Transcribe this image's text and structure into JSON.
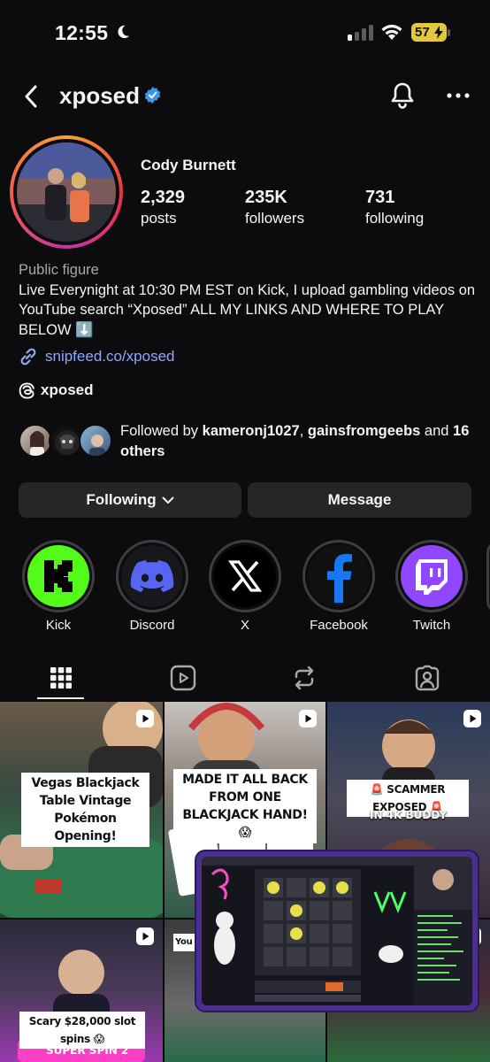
{
  "status_bar": {
    "time": "12:55",
    "battery": "57"
  },
  "header": {
    "username": "xposed"
  },
  "profile": {
    "display_name": "Cody Burnett",
    "stats": [
      {
        "value": "2,329",
        "label": "posts"
      },
      {
        "value": "235K",
        "label": "followers"
      },
      {
        "value": "731",
        "label": "following"
      }
    ],
    "category": "Public figure",
    "bio": "Live Everynight at 10:30 PM EST on Kick, I upload gambling videos on YouTube search “Xposed” ALL MY LINKS AND WHERE TO PLAY BELOW ⬇️",
    "link": "snipfeed.co/xposed",
    "threads": "xposed",
    "followed_by": {
      "prefix": "Followed by ",
      "user1": "kameronj1027",
      "separator": ", ",
      "user2": "gainsfromgeebs",
      "and_text": " and ",
      "others": "16 others"
    }
  },
  "actions": {
    "following_label": "Following",
    "message_label": "Message"
  },
  "highlights": [
    {
      "label": "Kick",
      "icon": "kick-icon",
      "color": "#53fc18"
    },
    {
      "label": "Discord",
      "icon": "discord-icon",
      "color": "#5865f2"
    },
    {
      "label": "X",
      "icon": "x-icon",
      "color": "#ffffff"
    },
    {
      "label": "Facebook",
      "icon": "facebook-icon",
      "color": "#1877f2"
    },
    {
      "label": "Twitch",
      "icon": "twitch-icon",
      "color": "#9146ff"
    }
  ],
  "posts": [
    {
      "caption": "Vegas Blackjack Table Vintage Pokémon Opening!"
    },
    {
      "caption": "MADE IT ALL BACK FROM ONE BLACKJACK HAND! 😱"
    },
    {
      "caption": "🚨 SCAMMER EXPOSED 🚨",
      "sub": "IN 4K BUDDY"
    },
    {
      "caption": "Scary $28,000 slot spins 😱",
      "sub": "SUPER SPIN 2"
    },
    {
      "caption": "You wo"
    }
  ],
  "colors": {
    "background": "#0c0c0e",
    "button": "#262628",
    "link": "#8fa8ff",
    "verified": "#3897f0"
  }
}
